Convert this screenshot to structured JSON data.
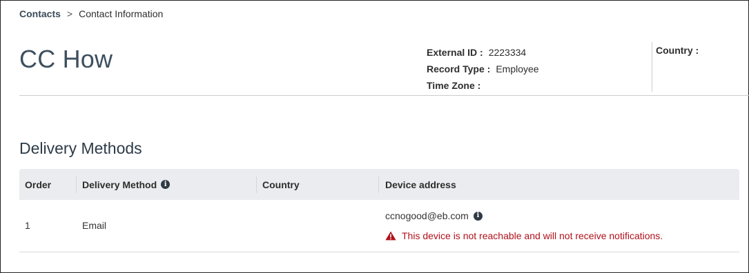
{
  "breadcrumb": {
    "parent": "Contacts",
    "separator": ">",
    "current": "Contact Information"
  },
  "contact": {
    "name": "CC How",
    "external_id_label": "External ID :",
    "external_id": "2223334",
    "record_type_label": "Record Type :",
    "record_type": "Employee",
    "time_zone_label": "Time Zone :",
    "time_zone": "",
    "country_label": "Country :",
    "country": ""
  },
  "delivery": {
    "section_title": "Delivery Methods",
    "columns": {
      "order": "Order",
      "method": "Delivery Method",
      "country": "Country",
      "device": "Device address"
    },
    "rows": [
      {
        "order": "1",
        "method": "Email",
        "country": "",
        "device": "ccnogood@eb.com",
        "warning": "This device is not reachable and will not receive notifications."
      }
    ]
  },
  "icons": {
    "info": "info-icon",
    "warning": "warning-triangle-icon"
  },
  "colors": {
    "warning": "#b0111b",
    "header_bg": "#eaecef",
    "title": "#3d4f5f"
  }
}
